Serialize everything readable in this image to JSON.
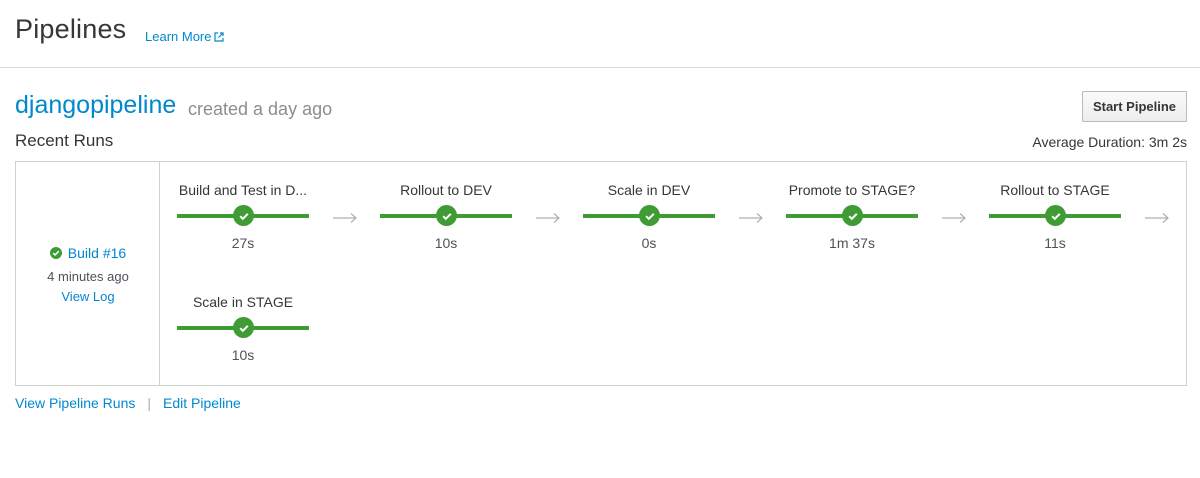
{
  "header": {
    "title": "Pipelines",
    "learn_more": "Learn More"
  },
  "pipeline": {
    "name": "djangopipeline",
    "created": "created a day ago",
    "start_button": "Start Pipeline",
    "recent_runs": "Recent Runs",
    "average_duration": "Average Duration: 3m 2s"
  },
  "build": {
    "label": "Build #16",
    "status": "complete",
    "time": "4 minutes ago",
    "view_log": "View Log"
  },
  "stages": [
    {
      "name": "Build and Test in D...",
      "duration": "27s",
      "status": "complete"
    },
    {
      "name": "Rollout to DEV",
      "duration": "10s",
      "status": "complete"
    },
    {
      "name": "Scale in DEV",
      "duration": "0s",
      "status": "complete"
    },
    {
      "name": "Promote to STAGE?",
      "duration": "1m 37s",
      "status": "complete"
    },
    {
      "name": "Rollout to STAGE",
      "duration": "11s",
      "status": "complete"
    },
    {
      "name": "Scale in STAGE",
      "duration": "10s",
      "status": "complete"
    }
  ],
  "footer": {
    "view_runs": "View Pipeline Runs",
    "separator": "|",
    "edit": "Edit Pipeline"
  },
  "colors": {
    "link": "#0088ce",
    "success": "#3f9c35",
    "border": "#d1d1d1"
  },
  "icons": {
    "external_link": "external-link-icon",
    "status": "check-circle-icon",
    "connector": "arrow-right-icon"
  }
}
